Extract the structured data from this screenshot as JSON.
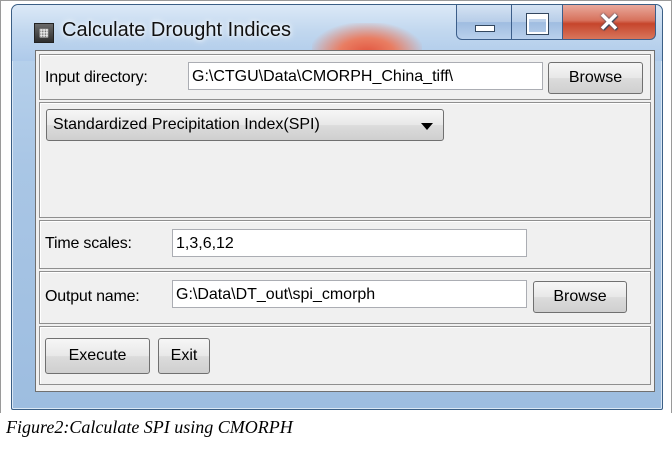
{
  "window": {
    "title": "Calculate Drought Indices",
    "icon": "app-icon"
  },
  "input": {
    "label": "Input directory:",
    "value": "G:\\CTGU\\Data\\CMORPH_China_tiff\\",
    "browse_label": "Browse"
  },
  "index_select": {
    "selected": "Standardized Precipitation Index(SPI)"
  },
  "time_scales": {
    "label": "Time scales:",
    "value": "1,3,6,12"
  },
  "output": {
    "label": "Output name:",
    "value": "G:\\Data\\DT_out\\spi_cmorph",
    "browse_label": "Browse"
  },
  "actions": {
    "execute_label": "Execute",
    "exit_label": "Exit"
  },
  "caption": "Figure2:Calculate SPI using CMORPH",
  "colors": {
    "titlebar": "#c2d8ef",
    "close_button": "#c6452c",
    "client_bg": "#f0f0f0"
  }
}
